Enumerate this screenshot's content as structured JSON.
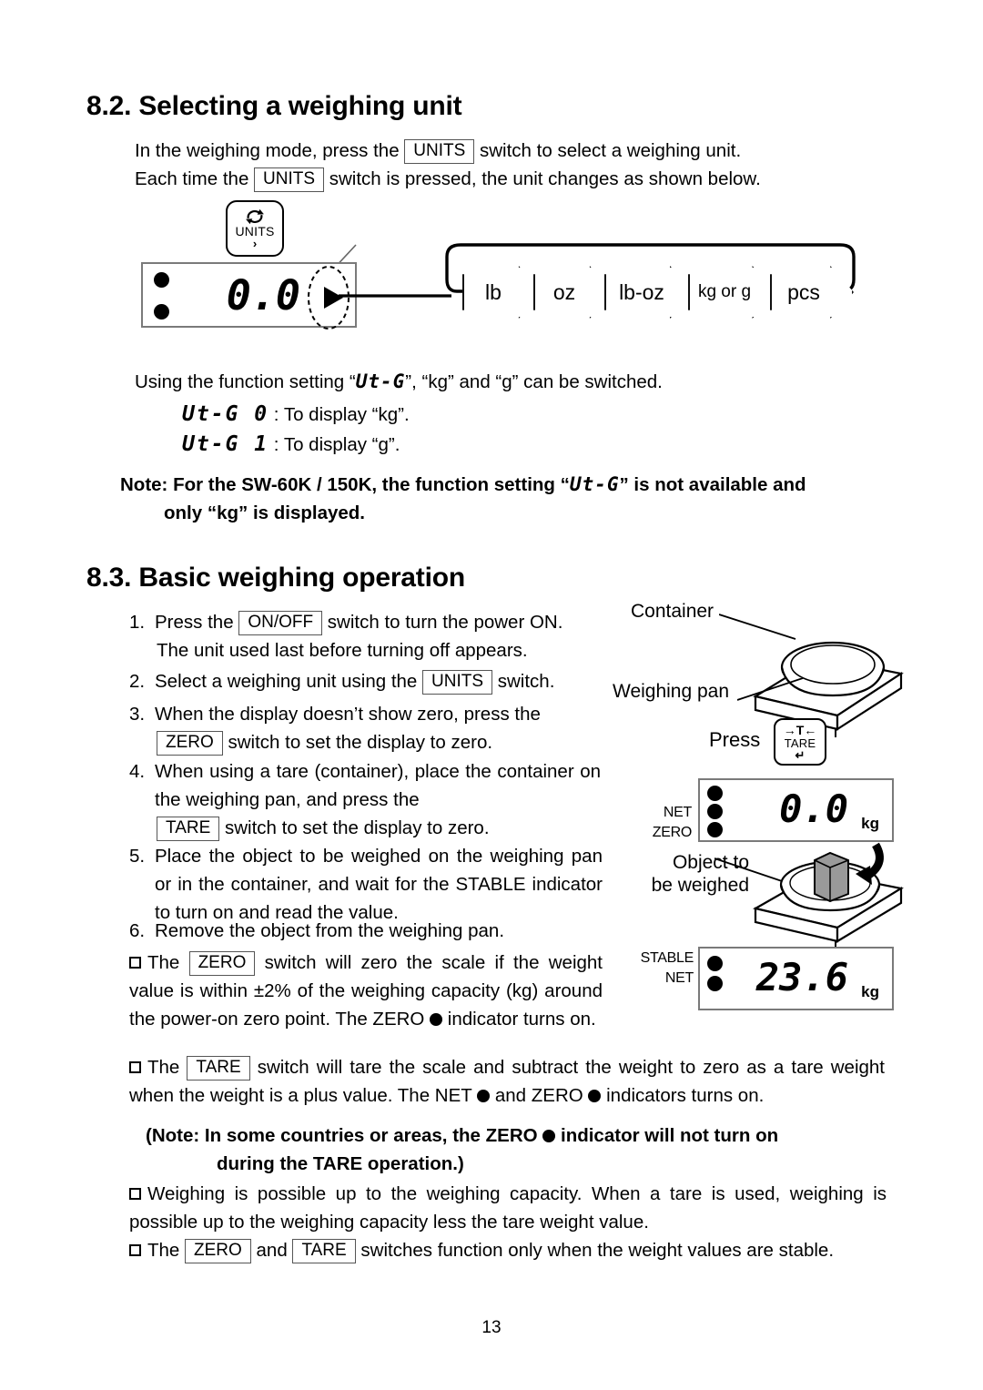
{
  "sections": {
    "s82": {
      "title": "8.2. Selecting a weighing unit",
      "intro_line1_a": "In the weighing mode, press the",
      "intro_line1_key": "UNITS",
      "intro_line1_b": "switch to select a weighing unit.",
      "intro_line2_a": "Each time the",
      "intro_line2_key": "UNITS",
      "intro_line2_b": "switch is pressed, the unit changes as shown below.",
      "func_line_a": "Using the function setting “",
      "func_setting": "Ut-G",
      "func_line_b": "”, “kg” and “g” can be switched.",
      "opt0_code": "Ut-G 0",
      "opt0_text": ": To display “kg”.",
      "opt1_code": "Ut-G 1",
      "opt1_text": ": To display “g”.",
      "note_a": "Note: For the SW-60K / 150K, the function setting “",
      "note_seg": "Ut-G",
      "note_b": "” is not available and",
      "note_line2": "only “kg” is displayed."
    },
    "s83": {
      "title": "8.3. Basic weighing operation",
      "steps": [
        {
          "num": "1.",
          "pre": "Press the",
          "key": "ON/OFF",
          "post": "switch to turn the power ON.",
          "line2": "The unit used last before turning off appears."
        },
        {
          "num": "2.",
          "pre": "Select a weighing unit using the",
          "key": "UNITS",
          "post": "switch.",
          "line2": ""
        },
        {
          "num": "3.",
          "pre": "When the display doesn’t show zero, press the",
          "key": "ZERO",
          "post": "switch to set the display to zero.",
          "line2": ""
        },
        {
          "num": "4.",
          "pre": "When using a tare (container), place the container on the weighing pan, and press the",
          "key": "TARE",
          "post": "switch to set the display to zero.",
          "line2": ""
        },
        {
          "num": "5.",
          "pre": "Place the object to be weighed on the weighing pan or in the container, and wait for the STABLE indicator to turn on and read the value.",
          "key": "",
          "post": "",
          "line2": ""
        },
        {
          "num": "6.",
          "pre": "Remove the object from the weighing pan.",
          "key": "",
          "post": "",
          "line2": ""
        }
      ],
      "bullets": {
        "b1_pre": "The",
        "b1_key": "ZERO",
        "b1_mid": "switch will zero the scale if the weight value is within ±2% of the weighing capacity (kg) around the power-on zero point. The ZERO",
        "b1_post": "indicator turns on.",
        "b2_pre": "The",
        "b2_key": "TARE",
        "b2_mid": "switch will tare the scale and subtract the weight to zero as a tare weight when the weight is a plus value. The NET",
        "b2_mid2": "and ZERO",
        "b2_post": "indicators turns on.",
        "b2_note_pre": "(Note: In some countries or areas, the ZERO",
        "b2_note_post": "indicator will not turn on",
        "b2_note_line2": "during the TARE operation.)",
        "b3": "Weighing is possible up to the weighing capacity. When a tare is used, weighing is possible up to the weighing capacity less the tare weight value.",
        "b4_pre": "The",
        "b4_key1": "ZERO",
        "b4_and": "and",
        "b4_key2": "TARE",
        "b4_post": "switches function only when the weight values are stable."
      }
    }
  },
  "unit_flow": {
    "items": [
      "lb",
      "oz",
      "lb-oz",
      "kg or g",
      "pcs"
    ]
  },
  "units_button": {
    "label": "UNITS",
    "sub": "›",
    "icon": "refresh-cycle-icon"
  },
  "tare_button": {
    "top": "→T←",
    "label": "TARE",
    "sub": "↵",
    "icon": "tare-arrow-icon"
  },
  "displays": {
    "top": {
      "value": "0.0",
      "unit": "",
      "indicators": [
        "",
        ""
      ]
    },
    "middle": {
      "value": "0.0",
      "unit": "kg",
      "indicators": [
        "",
        "NET",
        "ZERO"
      ]
    },
    "bottom": {
      "value": "23.6",
      "unit": "kg",
      "indicators": [
        "STABLE",
        "NET"
      ]
    }
  },
  "illustration": {
    "container_label": "Container",
    "pan_label": "Weighing pan",
    "press_label": "Press",
    "object_label_line1": "Object to",
    "object_label_line2": "be weighed"
  },
  "footer": {
    "page_number": "13"
  }
}
